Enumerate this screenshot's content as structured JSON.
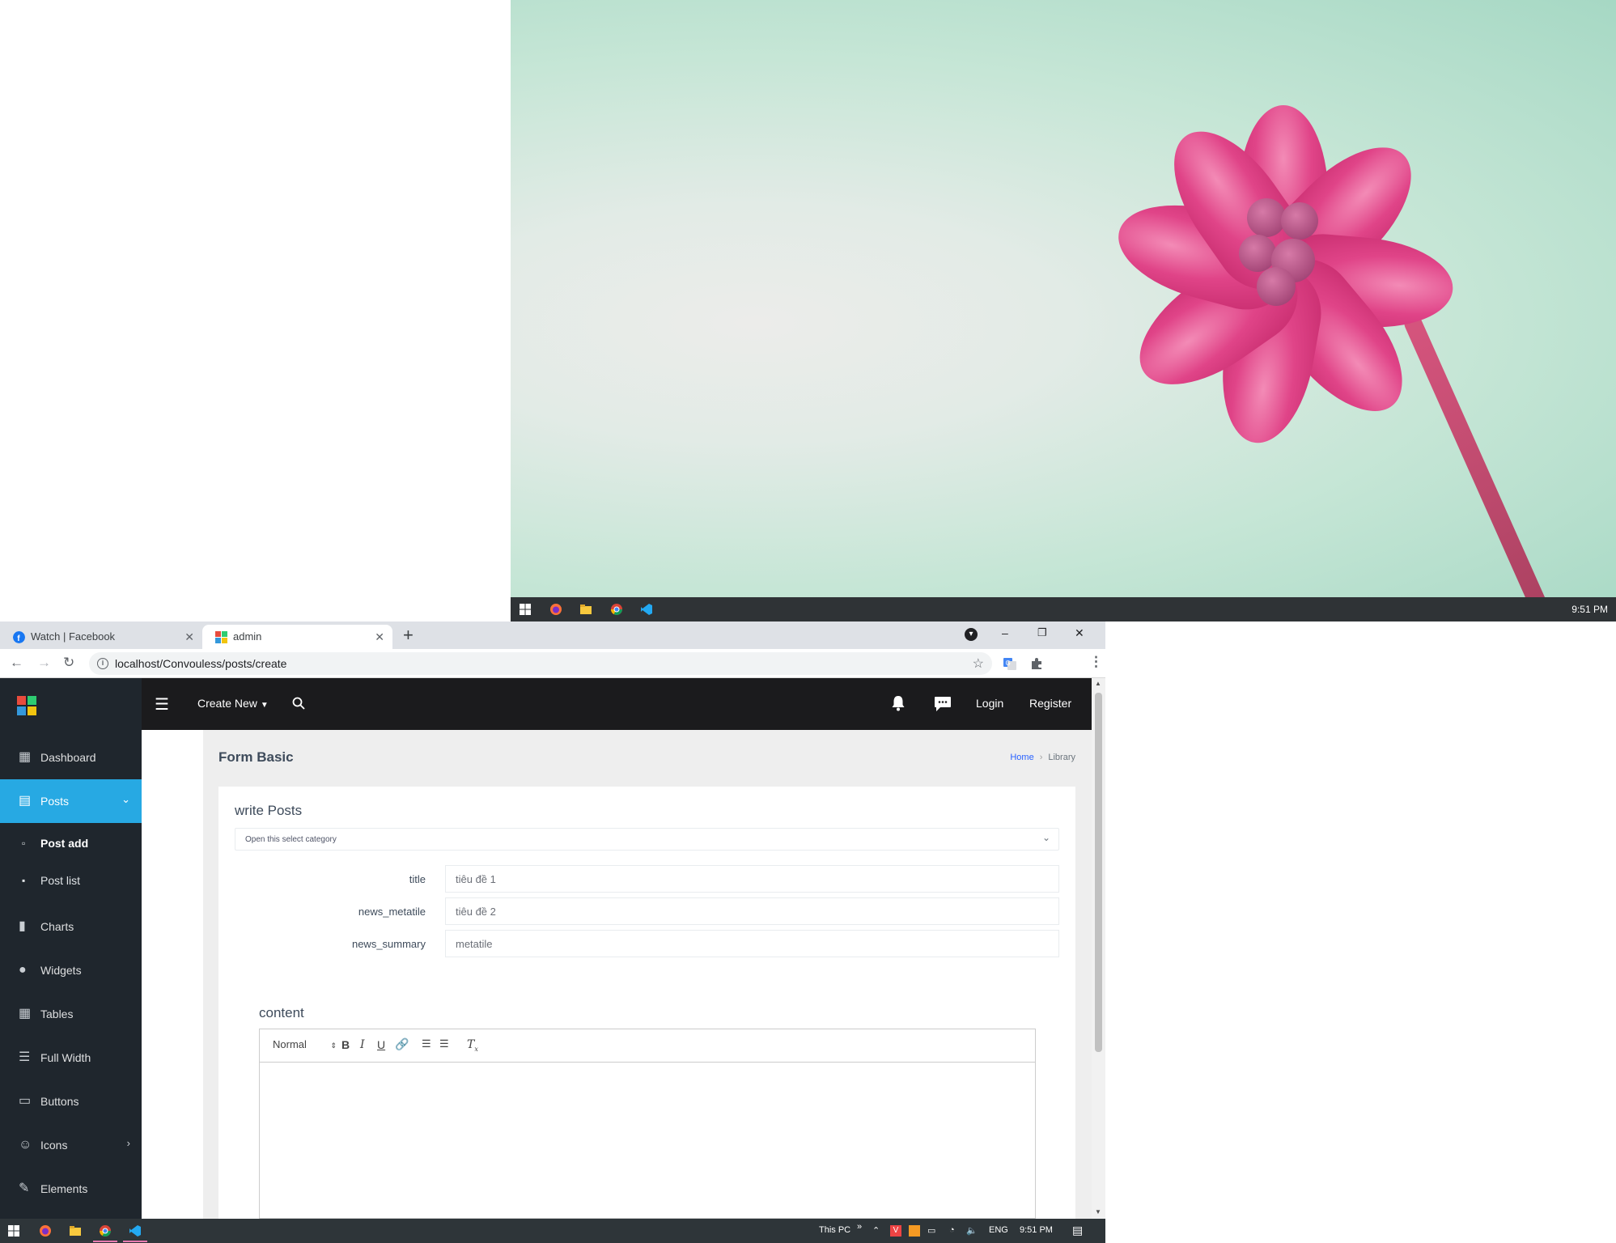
{
  "desktop": {
    "clock": "9:51 PM",
    "taskbar_icons": [
      "windows-start-icon",
      "firefox-icon",
      "file-explorer-icon",
      "chrome-icon",
      "vscode-icon"
    ]
  },
  "browser": {
    "tabs": [
      {
        "title": "Watch | Facebook",
        "favicon": "facebook-icon"
      },
      {
        "title": "admin",
        "favicon": "admin-logo-icon",
        "active": true
      }
    ],
    "new_tab": "+",
    "controls": {
      "minimize": "–",
      "restore": "❐",
      "close": "✕",
      "profile": "▾"
    },
    "url": "localhost/Convouless/posts/create"
  },
  "sidebar": {
    "items": [
      {
        "label": "Dashboard",
        "icon": "dashboard-icon"
      },
      {
        "label": "Posts",
        "icon": "posts-icon",
        "active": true,
        "expanded": true
      },
      {
        "label": "Charts",
        "icon": "chart-bar-icon"
      },
      {
        "label": "Widgets",
        "icon": "widgets-icon"
      },
      {
        "label": "Tables",
        "icon": "tables-icon"
      },
      {
        "label": "Full Width",
        "icon": "full-width-icon"
      },
      {
        "label": "Buttons",
        "icon": "buttons-icon"
      },
      {
        "label": "Icons",
        "icon": "icons-icon",
        "has_children": true
      },
      {
        "label": "Elements",
        "icon": "pencil-icon"
      }
    ],
    "subitems": [
      {
        "label": "Post add",
        "icon": "file-icon",
        "current": true
      },
      {
        "label": "Post list",
        "icon": "file-list-icon"
      }
    ]
  },
  "topbar": {
    "create_new": "Create New",
    "login": "Login",
    "register": "Register"
  },
  "page": {
    "title": "Form Basic",
    "breadcrumb": {
      "home": "Home",
      "current": "Library"
    }
  },
  "form": {
    "card_title": "write Posts",
    "category_select": "Open this select category",
    "fields": [
      {
        "label": "title",
        "value": "tiêu đề 1"
      },
      {
        "label": "news_metatile",
        "value": "tiêu đề 2"
      },
      {
        "label": "news_summary",
        "value": "metatile"
      }
    ],
    "content_label": "content",
    "editor": {
      "header_select": "Normal",
      "body": ""
    }
  },
  "win_taskbar": {
    "this_pc": "This PC",
    "language": "ENG",
    "clock": "9:51 PM"
  },
  "colors": {
    "sidebar_bg": "#1f262d",
    "sidebar_active": "#27a9e3",
    "topbar_bg": "#1b1b1d",
    "link_blue": "#2962ff",
    "taskbar_bg": "#2e3539"
  }
}
